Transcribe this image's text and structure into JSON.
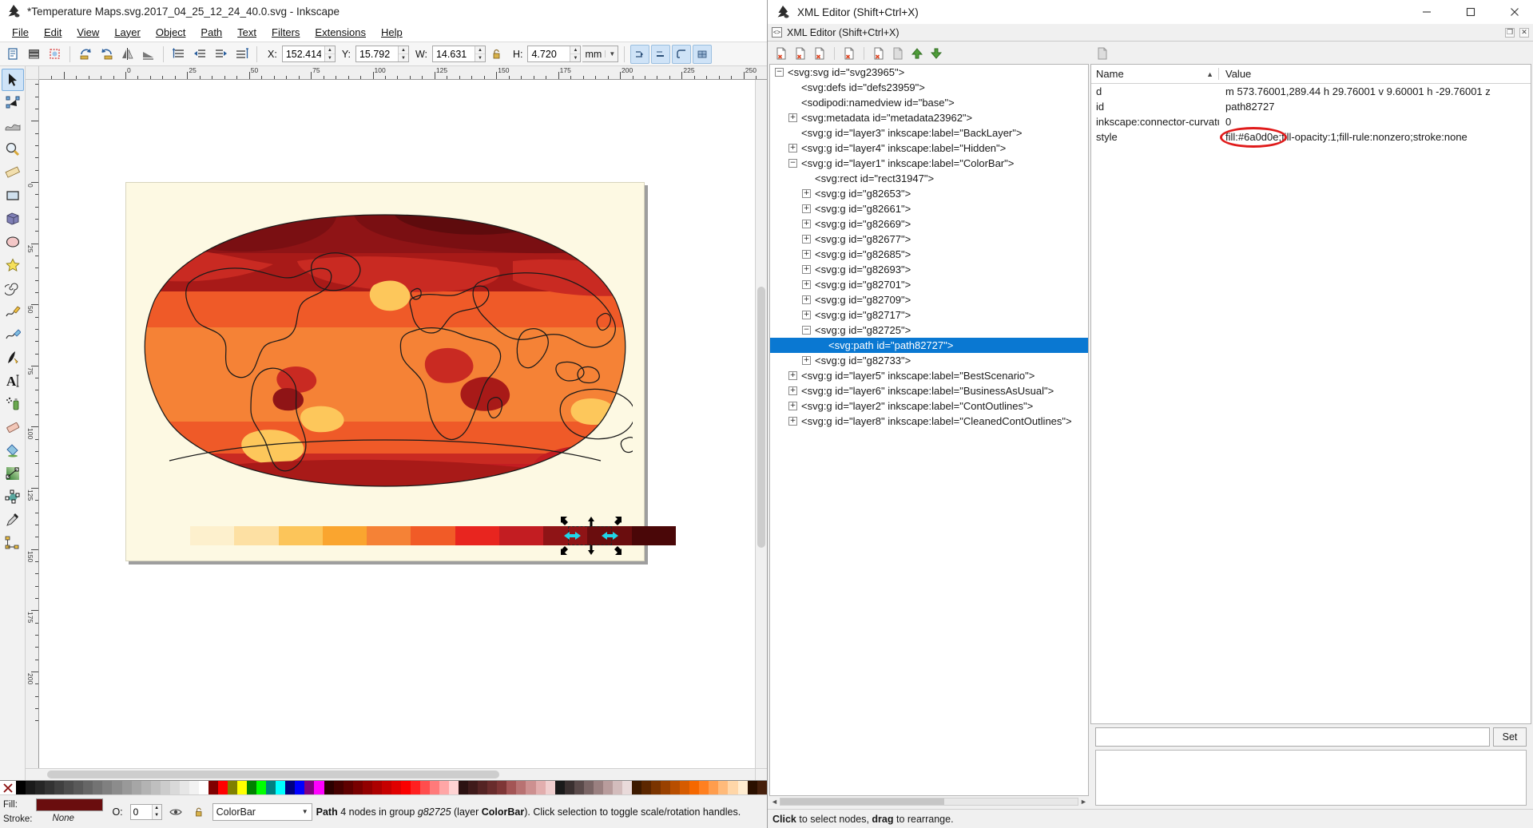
{
  "app": {
    "title": "*Temperature Maps.svg.2017_04_25_12_24_40.0.svg - Inkscape",
    "logo_icon": "inkscape-logo"
  },
  "menubar": {
    "items": [
      {
        "label": "File"
      },
      {
        "label": "Edit"
      },
      {
        "label": "View"
      },
      {
        "label": "Layer"
      },
      {
        "label": "Object"
      },
      {
        "label": "Path"
      },
      {
        "label": "Text"
      },
      {
        "label": "Filters"
      },
      {
        "label": "Extensions"
      },
      {
        "label": "Help"
      }
    ]
  },
  "toolbar": {
    "x_label": "X:",
    "x_value": "152.414",
    "y_label": "Y:",
    "y_value": "15.792",
    "w_label": "W:",
    "w_value": "14.631",
    "h_label": "H:",
    "h_value": "4.720",
    "unit_value": "mm",
    "lock_icon": "lock-open-icon",
    "buttons": [
      {
        "name": "select-all-icon"
      },
      {
        "name": "select-all-layers-icon"
      },
      {
        "name": "deselect-icon"
      },
      {
        "name": "rotate-90-ccw-icon"
      },
      {
        "name": "rotate-90-cw-icon"
      },
      {
        "name": "flip-horizontal-icon"
      },
      {
        "name": "flip-vertical-icon"
      },
      {
        "name": "raise-to-top-icon"
      },
      {
        "name": "raise-icon"
      },
      {
        "name": "lower-icon"
      },
      {
        "name": "lower-to-bottom-icon"
      }
    ],
    "right_buttons": [
      {
        "name": "affect-transform-icon"
      },
      {
        "name": "affect-stroke-width-icon"
      },
      {
        "name": "affect-rounded-corners-icon"
      },
      {
        "name": "affect-gradients-icon"
      }
    ]
  },
  "toolbox": {
    "tools": [
      {
        "name": "selector-tool",
        "icon": "arrow-pointer-icon",
        "selected": true
      },
      {
        "name": "node-tool",
        "icon": "node-editor-icon",
        "selected": false
      },
      {
        "name": "tweak-tool",
        "icon": "tweak-icon",
        "selected": false
      },
      {
        "name": "zoom-tool",
        "icon": "magnifier-icon",
        "selected": false
      },
      {
        "name": "measure-tool",
        "icon": "ruler-icon",
        "selected": false
      },
      {
        "name": "rectangle-tool",
        "icon": "rectangle-icon",
        "selected": false
      },
      {
        "name": "box3d-tool",
        "icon": "cube-icon",
        "selected": false
      },
      {
        "name": "ellipse-tool",
        "icon": "ellipse-icon",
        "selected": false
      },
      {
        "name": "star-tool",
        "icon": "star-icon",
        "selected": false
      },
      {
        "name": "spiral-tool",
        "icon": "spiral-icon",
        "selected": false
      },
      {
        "name": "pencil-tool",
        "icon": "pencil-icon",
        "selected": false
      },
      {
        "name": "bezier-tool",
        "icon": "pen-icon",
        "selected": false
      },
      {
        "name": "calligraphy-tool",
        "icon": "calligraphy-icon",
        "selected": false
      },
      {
        "name": "text-tool",
        "icon": "text-a-icon",
        "selected": false
      },
      {
        "name": "spray-tool",
        "icon": "spray-can-icon",
        "selected": false
      },
      {
        "name": "eraser-tool",
        "icon": "eraser-icon",
        "selected": false
      },
      {
        "name": "paint-bucket-tool",
        "icon": "paint-bucket-icon",
        "selected": false
      },
      {
        "name": "gradient-tool",
        "icon": "gradient-icon",
        "selected": false
      },
      {
        "name": "mesh-tool",
        "icon": "mesh-gradient-icon",
        "selected": false
      },
      {
        "name": "dropper-tool",
        "icon": "eyedropper-icon",
        "selected": false
      },
      {
        "name": "connector-tool",
        "icon": "connector-icon",
        "selected": false
      }
    ]
  },
  "rulers": {
    "h_labels": [
      "0",
      "25",
      "50",
      "75",
      "100",
      "125",
      "150",
      "175",
      "200"
    ],
    "v_labels": [
      "0",
      "25",
      "50",
      "75",
      "100",
      "125",
      "150"
    ]
  },
  "canvas": {
    "page_background": "#fdf9e3",
    "colorbar_colors": [
      "#fdf0cd",
      "#fde0a3",
      "#fcc55a",
      "#faa52f",
      "#f58236",
      "#f15b27",
      "#e8251f",
      "#c31d22",
      "#8f1416",
      "#6a0d0e",
      "#4a0708"
    ],
    "map_colors": {
      "deep_red": "#8f1416",
      "red": "#c92a22",
      "orange_red": "#ef5a28",
      "orange": "#f58236",
      "light_orange": "#faa52f",
      "yellow": "#fdc75b"
    }
  },
  "palette": {
    "none_icon": "no-color-x-icon",
    "swatches": [
      "#000000",
      "#1a1a1a",
      "#262626",
      "#333333",
      "#404040",
      "#4d4d4d",
      "#595959",
      "#666666",
      "#737373",
      "#808080",
      "#8c8c8c",
      "#999999",
      "#a6a6a6",
      "#b3b3b3",
      "#bfbfbf",
      "#cccccc",
      "#d9d9d9",
      "#e6e6e6",
      "#f2f2f2",
      "#ffffff",
      "#800000",
      "#ff0000",
      "#808000",
      "#ffff00",
      "#008000",
      "#00ff00",
      "#008080",
      "#00ffff",
      "#000080",
      "#0000ff",
      "#800080",
      "#ff00ff",
      "#2b0000",
      "#450000",
      "#5e0000",
      "#780000",
      "#920000",
      "#ac0000",
      "#c60000",
      "#e00000",
      "#fa0000",
      "#ff2020",
      "#ff4d4d",
      "#ff7a7a",
      "#ffa6a6",
      "#ffd3d3",
      "#2b1111",
      "#3f1a1a",
      "#542323",
      "#692c2c",
      "#7e3636",
      "#a35555",
      "#b87272",
      "#cd9090",
      "#e2aeae",
      "#f0cfcf",
      "#1a1a1a",
      "#3a3030",
      "#5a4a4a",
      "#7a6565",
      "#9a8080",
      "#b89c9c",
      "#d3bcbc",
      "#e9dada",
      "#3d1a00",
      "#5c2700",
      "#7a3400",
      "#994100",
      "#b84e00",
      "#d65b00",
      "#f56800",
      "#ff8020",
      "#ff9d4d",
      "#ffba7a",
      "#ffd6a8",
      "#ffecd0",
      "#2b1000",
      "#46200c"
    ]
  },
  "statusbar": {
    "fill_label": "Fill:",
    "stroke_label": "Stroke:",
    "fill_color": "#6a0d0e",
    "stroke_value": "None",
    "opacity_label": "O:",
    "opacity_value": "0",
    "layer_visibility_icon": "eye-icon",
    "layer_lock_icon": "lock-open-icon",
    "layer_name": "ColorBar",
    "message_prefix": "Path",
    "message_body": " 4 nodes in group ",
    "message_group": "g82725",
    "message_mid": " (layer ",
    "message_layer": "ColorBar",
    "message_suffix": "). Click selection to toggle scale/rotation handles."
  },
  "xml_window": {
    "title": "XML Editor (Shift+Ctrl+X)",
    "dock_title": "XML Editor (Shift+Ctrl+X)",
    "minimize_icon": "minimize-icon",
    "maximize_icon": "maximize-icon",
    "close_icon": "close-icon",
    "dock_float_icon": "float-dialog-icon",
    "dock_close_icon": "close-dialog-icon",
    "toolbar_buttons": [
      {
        "name": "new-element-node-icon"
      },
      {
        "name": "new-text-node-icon"
      },
      {
        "name": "duplicate-node-icon"
      },
      {
        "name": "delete-node-icon"
      },
      {
        "name": "unindent-node-icon"
      },
      {
        "name": "indent-node-icon"
      },
      {
        "name": "move-node-up-icon"
      },
      {
        "name": "move-node-down-icon"
      }
    ],
    "attr_toolbar_buttons": [
      {
        "name": "new-attribute-icon"
      }
    ],
    "tree": [
      {
        "indent": 0,
        "twisty": "minus",
        "label": "<svg:svg id=\"svg23965\">",
        "selected": false
      },
      {
        "indent": 1,
        "twisty": "none",
        "label": "<svg:defs id=\"defs23959\">",
        "selected": false
      },
      {
        "indent": 1,
        "twisty": "none",
        "label": "<sodipodi:namedview id=\"base\">",
        "selected": false
      },
      {
        "indent": 1,
        "twisty": "plus",
        "label": "<svg:metadata id=\"metadata23962\">",
        "selected": false
      },
      {
        "indent": 1,
        "twisty": "none",
        "label": "<svg:g id=\"layer3\" inkscape:label=\"BackLayer\">",
        "selected": false
      },
      {
        "indent": 1,
        "twisty": "plus",
        "label": "<svg:g id=\"layer4\" inkscape:label=\"Hidden\">",
        "selected": false
      },
      {
        "indent": 1,
        "twisty": "minus",
        "label": "<svg:g id=\"layer1\" inkscape:label=\"ColorBar\">",
        "selected": false
      },
      {
        "indent": 2,
        "twisty": "none",
        "label": "<svg:rect id=\"rect31947\">",
        "selected": false
      },
      {
        "indent": 2,
        "twisty": "plus",
        "label": "<svg:g id=\"g82653\">",
        "selected": false
      },
      {
        "indent": 2,
        "twisty": "plus",
        "label": "<svg:g id=\"g82661\">",
        "selected": false
      },
      {
        "indent": 2,
        "twisty": "plus",
        "label": "<svg:g id=\"g82669\">",
        "selected": false
      },
      {
        "indent": 2,
        "twisty": "plus",
        "label": "<svg:g id=\"g82677\">",
        "selected": false
      },
      {
        "indent": 2,
        "twisty": "plus",
        "label": "<svg:g id=\"g82685\">",
        "selected": false
      },
      {
        "indent": 2,
        "twisty": "plus",
        "label": "<svg:g id=\"g82693\">",
        "selected": false
      },
      {
        "indent": 2,
        "twisty": "plus",
        "label": "<svg:g id=\"g82701\">",
        "selected": false
      },
      {
        "indent": 2,
        "twisty": "plus",
        "label": "<svg:g id=\"g82709\">",
        "selected": false
      },
      {
        "indent": 2,
        "twisty": "plus",
        "label": "<svg:g id=\"g82717\">",
        "selected": false
      },
      {
        "indent": 2,
        "twisty": "minus",
        "label": "<svg:g id=\"g82725\">",
        "selected": false
      },
      {
        "indent": 3,
        "twisty": "none",
        "label": "<svg:path id=\"path82727\">",
        "selected": true
      },
      {
        "indent": 2,
        "twisty": "plus",
        "label": "<svg:g id=\"g82733\">",
        "selected": false
      },
      {
        "indent": 1,
        "twisty": "plus",
        "label": "<svg:g id=\"layer5\" inkscape:label=\"BestScenario\">",
        "selected": false
      },
      {
        "indent": 1,
        "twisty": "plus",
        "label": "<svg:g id=\"layer6\" inkscape:label=\"BusinessAsUsual\">",
        "selected": false
      },
      {
        "indent": 1,
        "twisty": "plus",
        "label": "<svg:g id=\"layer2\" inkscape:label=\"ContOutlines\">",
        "selected": false
      },
      {
        "indent": 1,
        "twisty": "plus",
        "label": "<svg:g id=\"layer8\" inkscape:label=\"CleanedContOutlines\">",
        "selected": false
      }
    ],
    "attributes": {
      "col_name": "Name",
      "col_value": "Value",
      "sort_icon": "sort-ascending-icon",
      "rows": [
        {
          "name": "d",
          "value": "m 573.76001,289.44 h 29.76001 v 9.60001 h -29.76001 z",
          "highlighted": false
        },
        {
          "name": "id",
          "value": "path82727",
          "highlighted": false
        },
        {
          "name": "inkscape:connector-curvature",
          "value": "0",
          "highlighted": false
        },
        {
          "name": "style",
          "value": "fill:#6a0d0e;fill-opacity:1;fill-rule:nonzero;stroke:none",
          "highlighted": true
        }
      ]
    },
    "value_editor": {
      "value": "",
      "set_label": "Set"
    },
    "status": {
      "bold1": "Click",
      "mid1": " to select nodes, ",
      "bold2": "drag",
      "mid2": " to rearrange."
    },
    "annotation": {
      "highlight_color": "#e01b1b",
      "target_text": "fill:#6a0d0e"
    }
  }
}
